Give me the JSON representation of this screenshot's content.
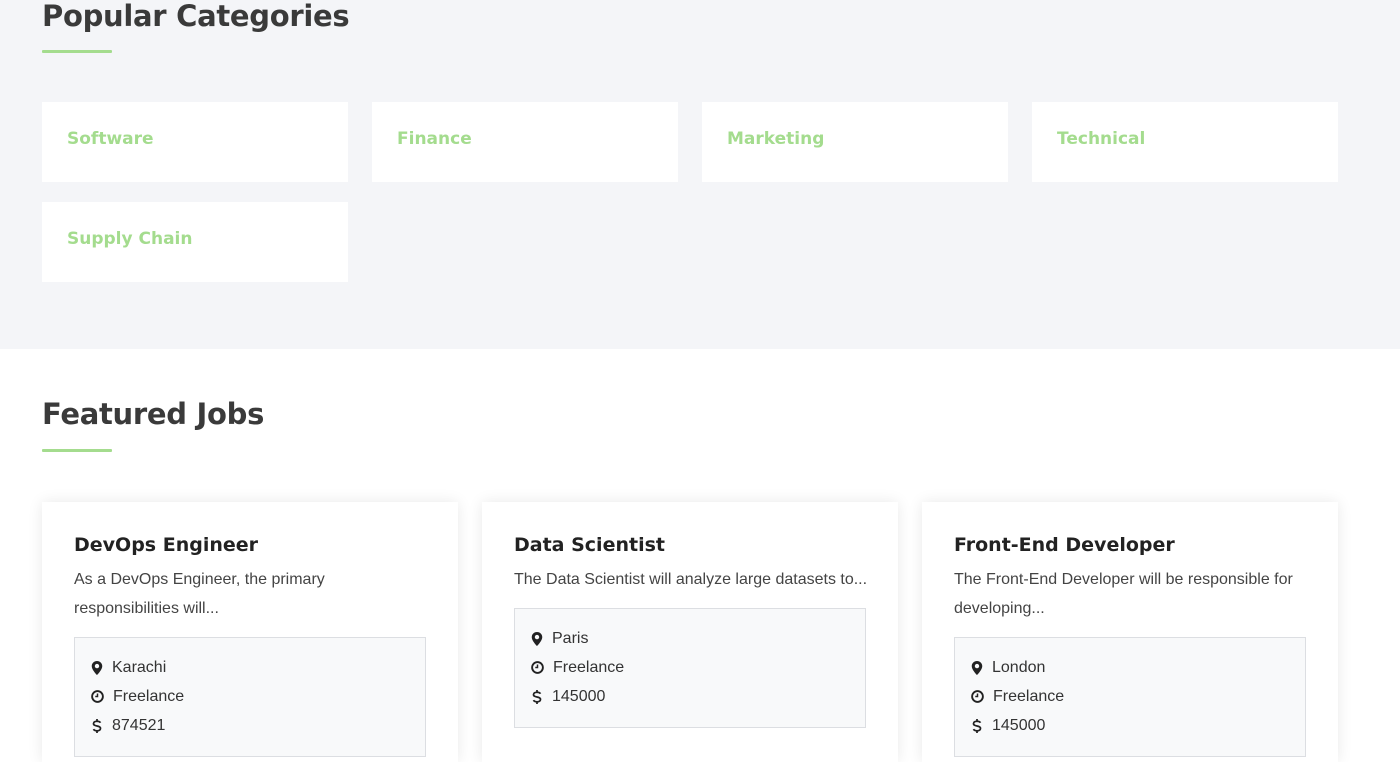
{
  "categories_section": {
    "title": "Popular Categories",
    "accent_color": "#a4dc8e",
    "items": [
      {
        "label": "Software"
      },
      {
        "label": "Finance"
      },
      {
        "label": "Marketing"
      },
      {
        "label": "Technical"
      },
      {
        "label": "Supply Chain"
      }
    ]
  },
  "jobs_section": {
    "title": "Featured Jobs",
    "jobs": [
      {
        "title": "DevOps Engineer",
        "description": "As a DevOps Engineer, the primary responsibilities will...",
        "location": "Karachi",
        "type": "Freelance",
        "salary": "874521",
        "icons": {
          "location": "map-pin-icon",
          "type": "clock-icon",
          "salary": "dollar-icon"
        }
      },
      {
        "title": "Data Scientist",
        "description": "The Data Scientist will analyze large datasets to...",
        "location": "Paris",
        "type": "Freelance",
        "salary": "145000",
        "icons": {
          "location": "map-pin-icon",
          "type": "clock-icon",
          "salary": "dollar-icon"
        }
      },
      {
        "title": "Front-End Developer",
        "description": "The Front-End Developer will be responsible for developing...",
        "location": "London",
        "type": "Freelance",
        "salary": "145000",
        "icons": {
          "location": "map-pin-icon",
          "type": "clock-icon",
          "salary": "dollar-icon"
        }
      }
    ]
  }
}
